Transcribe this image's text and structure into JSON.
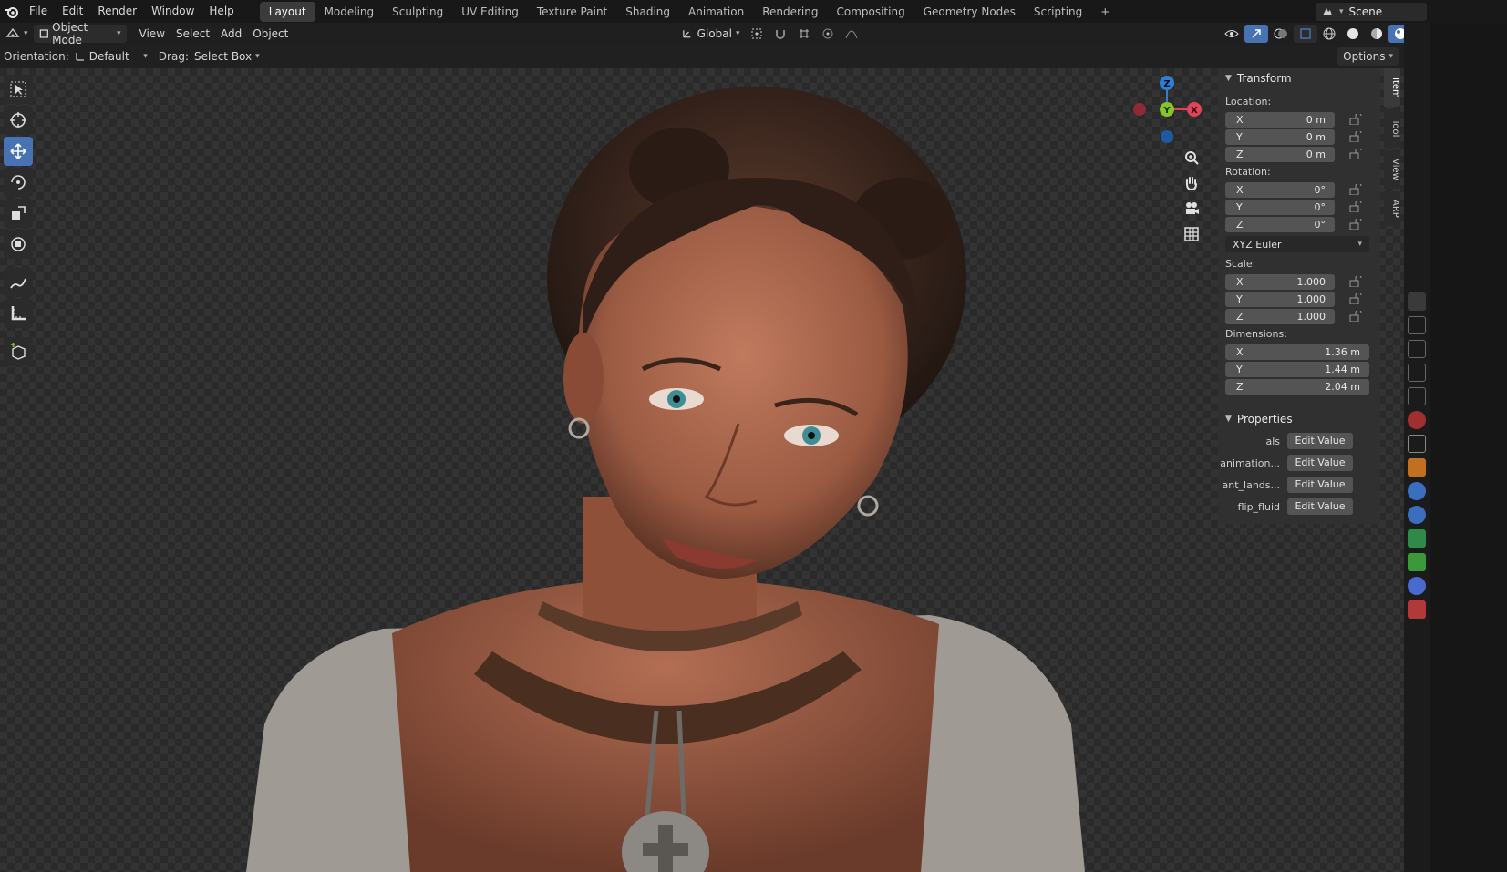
{
  "menu": [
    "File",
    "Edit",
    "Render",
    "Window",
    "Help"
  ],
  "workspaces": [
    {
      "label": "Layout",
      "active": true
    },
    {
      "label": "Modeling"
    },
    {
      "label": "Sculpting"
    },
    {
      "label": "UV Editing"
    },
    {
      "label": "Texture Paint"
    },
    {
      "label": "Shading"
    },
    {
      "label": "Animation"
    },
    {
      "label": "Rendering"
    },
    {
      "label": "Compositing"
    },
    {
      "label": "Geometry Nodes"
    },
    {
      "label": "Scripting"
    }
  ],
  "add_workspace": "+",
  "scene": {
    "label": "Scene"
  },
  "header": {
    "mode": "Object Mode",
    "menus": [
      "View",
      "Select",
      "Add",
      "Object"
    ],
    "transform_orientation": "Global",
    "options": "Options"
  },
  "toolsettings": {
    "orientation_label": "Orientation:",
    "orientation_value": "Default",
    "drag_label": "Drag:",
    "drag_value": "Select Box"
  },
  "gizmo": {
    "x": "X",
    "y": "Y",
    "z": "Z"
  },
  "npanel": {
    "transform_title": "Transform",
    "location_label": "Location:",
    "location": [
      {
        "axis": "X",
        "value": "0 m"
      },
      {
        "axis": "Y",
        "value": "0 m"
      },
      {
        "axis": "Z",
        "value": "0 m"
      }
    ],
    "rotation_label": "Rotation:",
    "rotation": [
      {
        "axis": "X",
        "value": "0°"
      },
      {
        "axis": "Y",
        "value": "0°"
      },
      {
        "axis": "Z",
        "value": "0°"
      }
    ],
    "rotation_mode": "XYZ Euler",
    "scale_label": "Scale:",
    "scale": [
      {
        "axis": "X",
        "value": "1.000"
      },
      {
        "axis": "Y",
        "value": "1.000"
      },
      {
        "axis": "Z",
        "value": "1.000"
      }
    ],
    "dimensions_label": "Dimensions:",
    "dimensions": [
      {
        "axis": "X",
        "value": "1.36 m"
      },
      {
        "axis": "Y",
        "value": "1.44 m"
      },
      {
        "axis": "Z",
        "value": "2.04 m"
      }
    ],
    "properties_title": "Properties",
    "properties": [
      {
        "key": "als",
        "button": "Edit Value"
      },
      {
        "key": "animation...",
        "button": "Edit Value"
      },
      {
        "key": "ant_lands...",
        "button": "Edit Value"
      },
      {
        "key": "flip_fluid",
        "button": "Edit Value"
      }
    ]
  },
  "vtabs": [
    {
      "label": "Item",
      "active": true
    },
    {
      "label": "Tool"
    },
    {
      "label": "View"
    },
    {
      "label": "ARP"
    }
  ],
  "colors": {
    "accent": "#4772b3",
    "axis_x": "#e0445a",
    "axis_y": "#8ac22a",
    "axis_z": "#2f7fd6"
  }
}
